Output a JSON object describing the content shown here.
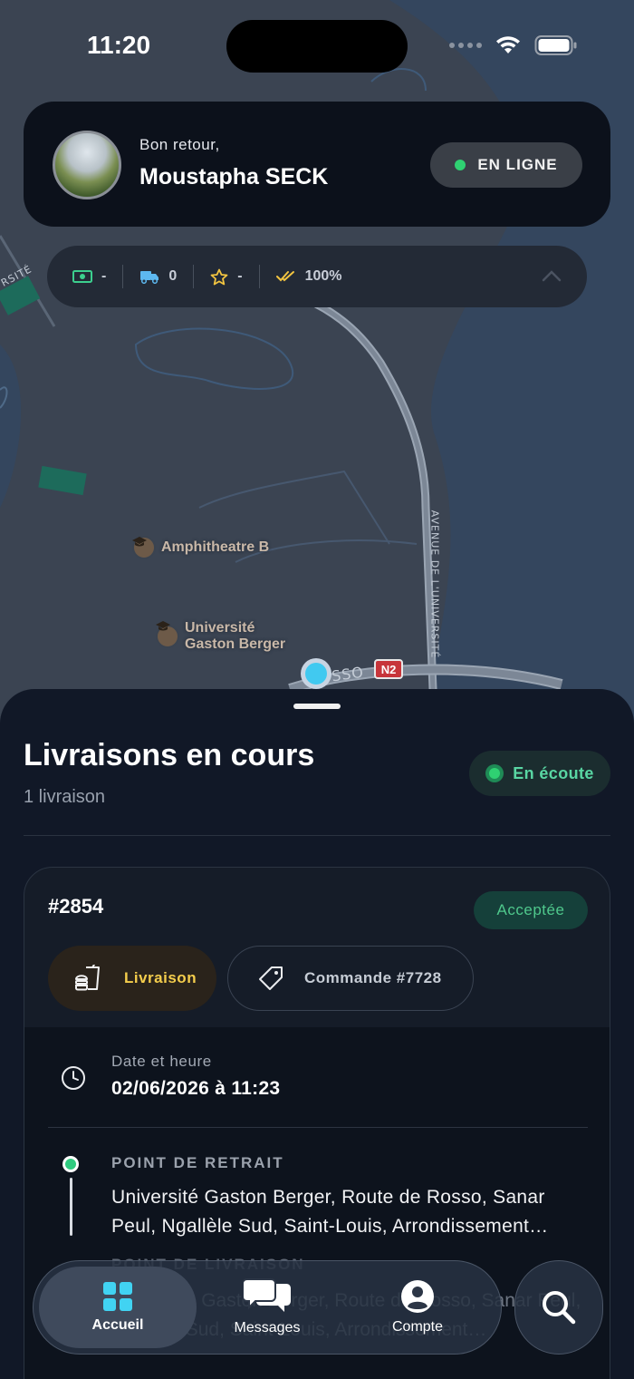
{
  "status_bar": {
    "time": "11:20"
  },
  "header": {
    "greeting": "Bon retour,",
    "user_name": "Moustapha SECK",
    "online_label": "EN LIGNE",
    "online_color": "#2fd172"
  },
  "stats": {
    "earnings": "-",
    "deliveries": "0",
    "rating": "-",
    "acceptance": "100%"
  },
  "map": {
    "pois": [
      {
        "name": "Amphitheatre B",
        "icon": "graduation-cap-icon"
      },
      {
        "name_line1": "Université",
        "name_line2": "Gaston Berger",
        "icon": "graduation-cap-icon"
      }
    ],
    "road_labels": {
      "avenue": "AVENUE DE L'UNIVERSITÉ",
      "route": "SSO",
      "left_road": "RSITÉ",
      "n2": "N2"
    }
  },
  "sheet": {
    "title": "Livraisons en cours",
    "subtitle": "1 livraison",
    "listening_label": "En écoute"
  },
  "delivery": {
    "order_id": "#2854",
    "status": "Acceptée",
    "type_label": "Livraison",
    "order_ref": "Commande #7728",
    "datetime_label": "Date et heure",
    "datetime_value": "02/06/2026 à 11:23",
    "pickup_label": "POINT DE RETRAIT",
    "pickup_address": "Université Gaston Berger, Route de Rosso, Sanar Peul, Ngallèle Sud, Saint-Louis, Arrondissement…",
    "dropoff_label": "POINT DE LIVRAISON",
    "dropoff_address": "Université Gaston Berger, Route de Rosso, Sanar Peul, Ngallèle Sud, Saint-Louis, Arrondissement…"
  },
  "tabbar": {
    "home": "Accueil",
    "messages": "Messages",
    "account": "Compte"
  },
  "colors": {
    "accent_green": "#2fd172",
    "accent_yellow": "#f4cd4c",
    "accent_cyan": "#41c9f0"
  }
}
